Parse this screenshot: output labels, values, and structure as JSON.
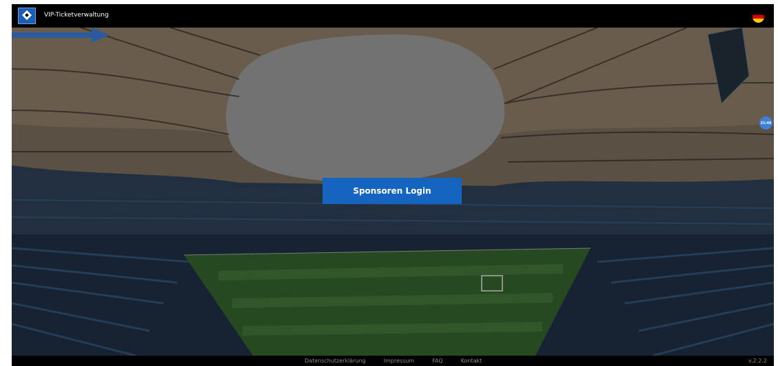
{
  "header": {
    "app_title": "VIP-Ticketverwaltung"
  },
  "hero": {
    "login_button": "Sponsoren Login",
    "side_badge": "21:46"
  },
  "footer": {
    "links": [
      "Datenschutzerklärung",
      "Impressum",
      "FAQ",
      "Kontakt"
    ],
    "version": "v.2.2.2"
  },
  "colors": {
    "accent": "#1565c0",
    "header_bg": "#000000",
    "arrow": "#2c5aa0"
  },
  "icons": {
    "logo": "hsv-diamond-logo",
    "language": "german-flag-icon",
    "pointer": "arrow-right-icon"
  }
}
